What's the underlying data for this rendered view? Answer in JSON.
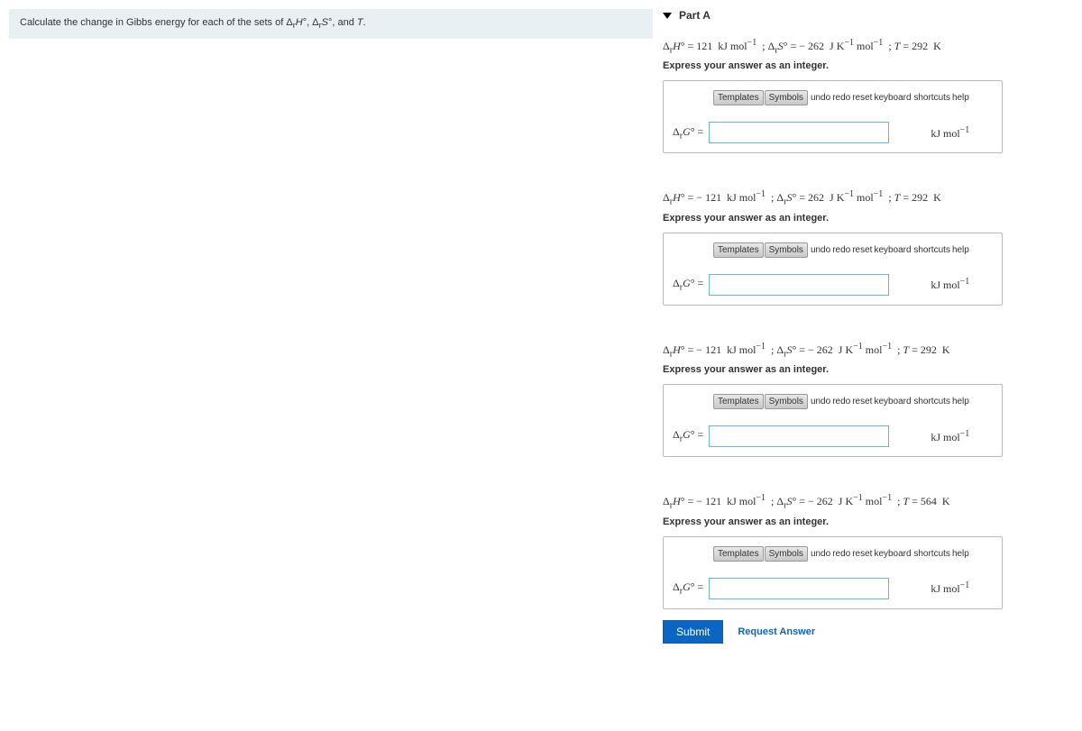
{
  "question": "Calculate the change in Gibbs energy for each of the sets of Δ_rH°, Δ_rS°, and T.",
  "part_label": "Part A",
  "instruct": "Express your answer as an integer.",
  "toolbar": {
    "templates": "Templates",
    "symbols": "Symbols",
    "undo": "undo",
    "redo": "redo",
    "reset": "reset",
    "kbd": "keyboard shortcuts",
    "help": "help"
  },
  "dg_label": "Δ_rG° =",
  "unit": "kJ mol⁻¹",
  "subparts": [
    {
      "equation": "Δ_rH° = 121 kJ mol⁻¹ ; Δ_rS° = − 262 J K⁻¹ mol⁻¹ ; T = 292 K"
    },
    {
      "equation": "Δ_rH° = − 121 kJ mol⁻¹ ; Δ_rS° = 262 J K⁻¹ mol⁻¹ ; T = 292 K"
    },
    {
      "equation": "Δ_rH° = − 121 kJ mol⁻¹ ; Δ_rS° = − 262 J K⁻¹ mol⁻¹ ; T = 292 K"
    },
    {
      "equation": "Δ_rH° = − 121 kJ mol⁻¹ ; Δ_rS° = − 262 J K⁻¹ mol⁻¹ ; T = 564 K"
    }
  ],
  "submit": "Submit",
  "request_answer": "Request Answer"
}
